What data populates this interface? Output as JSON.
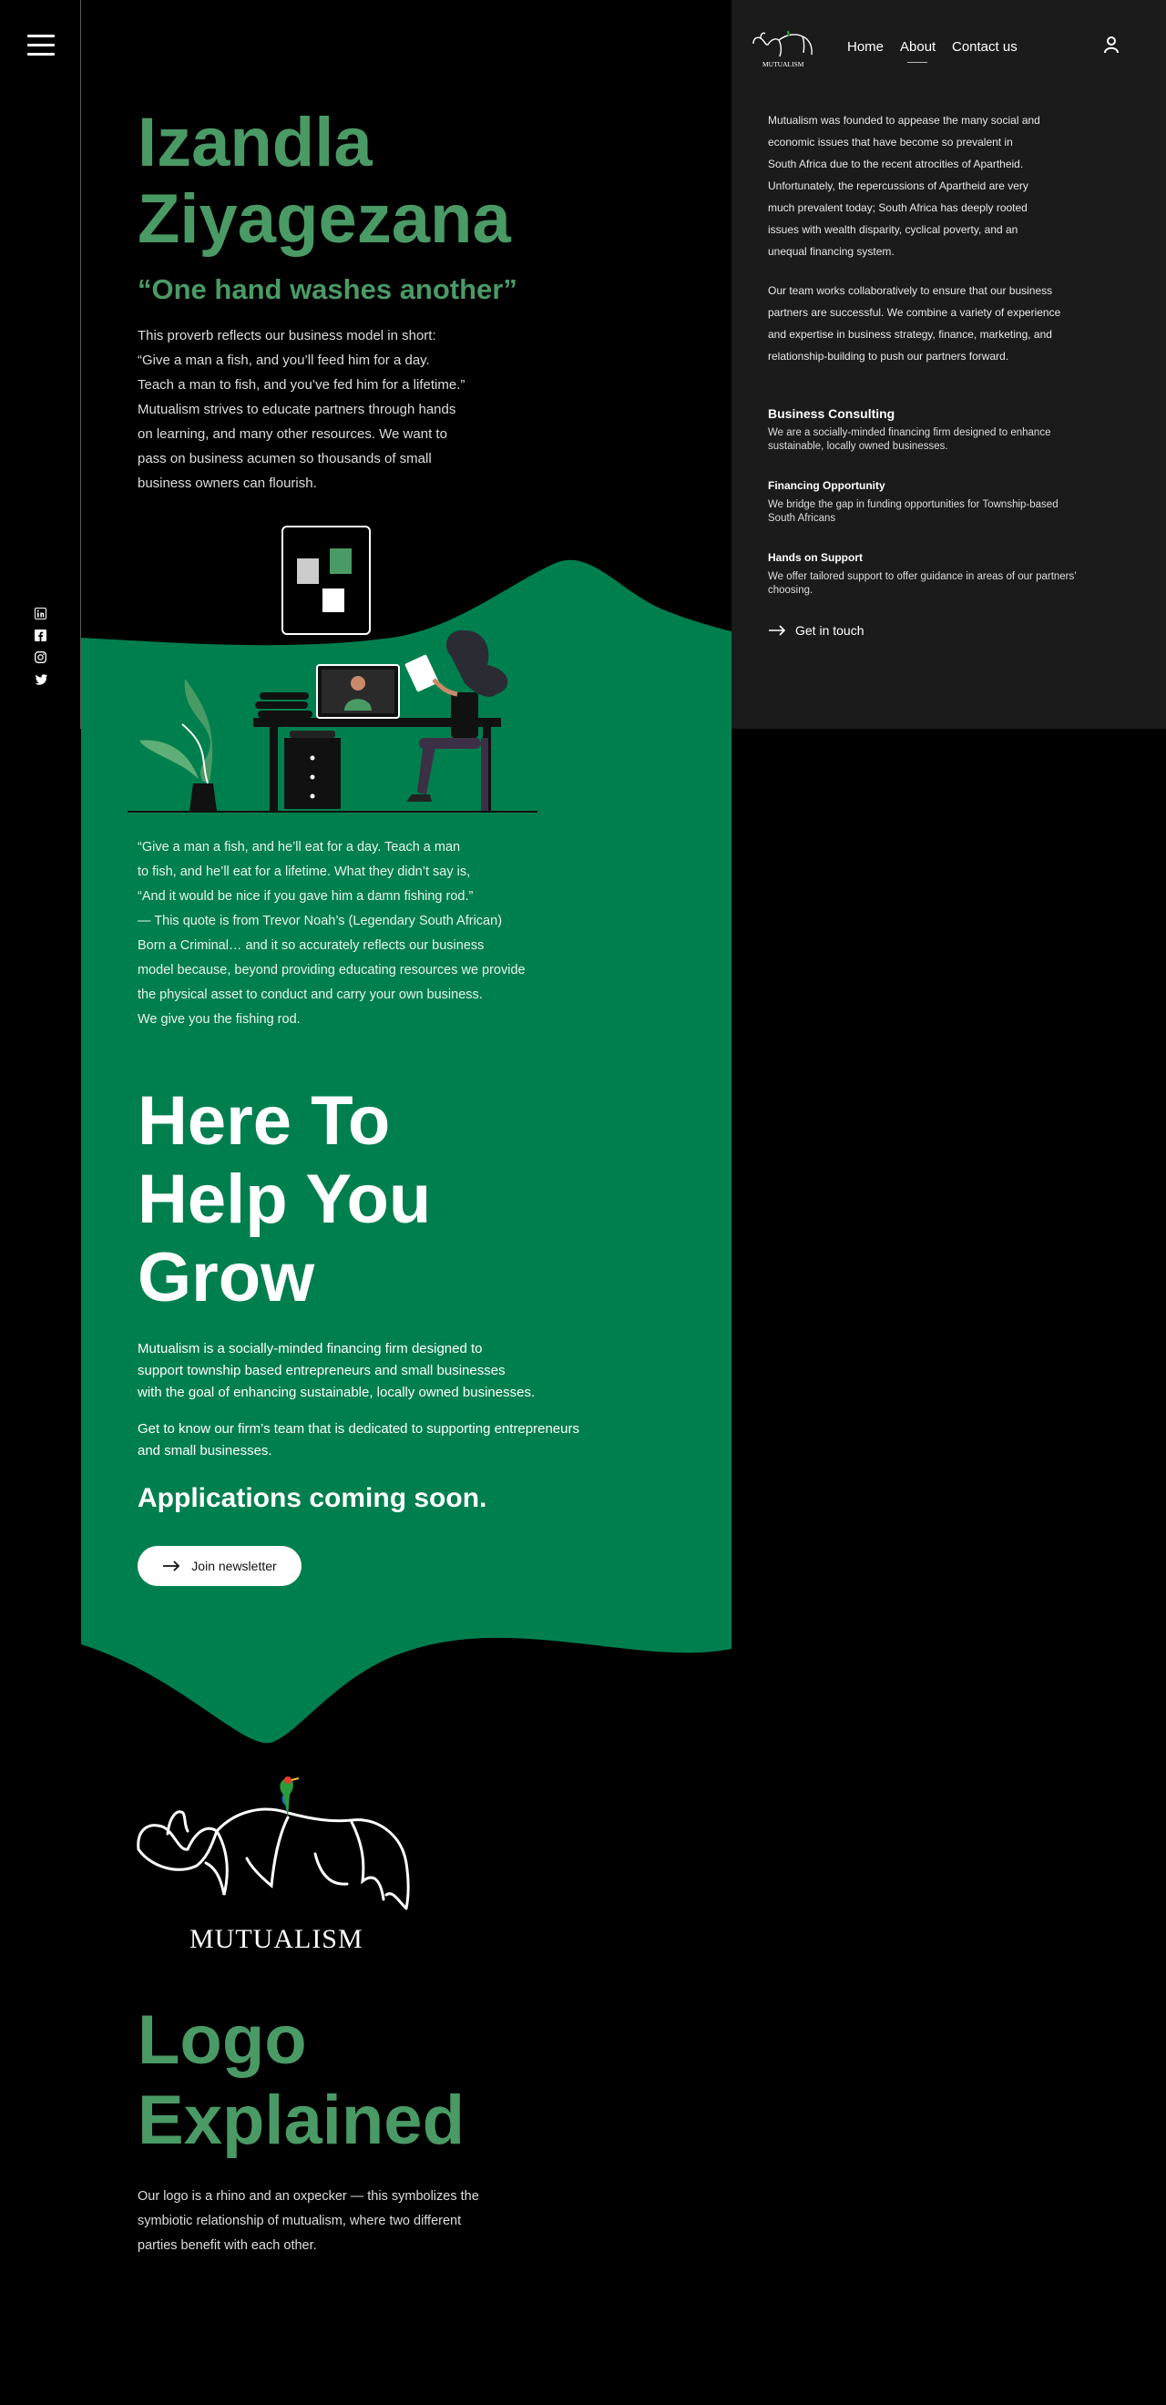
{
  "nav": {
    "logo_text": "MUTUALISM",
    "links": [
      "Home",
      "About",
      "Contact us"
    ],
    "active": "About"
  },
  "hero": {
    "title_line1": "Izandla",
    "title_line2": "Ziyagezana",
    "subtitle": "“One hand washes another”",
    "body": [
      "This proverb reflects our business model in short:",
      "“Give a man a fish, and you’ll feed him for a day.",
      "Teach a man to fish, and you’ve fed him for a lifetime.”",
      "Mutualism strives to educate partners through hands",
      "on learning, and many other resources. We want to",
      "pass on business acumen so thousands of small",
      "business owners can flourish."
    ]
  },
  "about_panel": {
    "para1": [
      "Mutualism was founded to appease the many social and",
      "economic issues that have become so prevalent in",
      "South Africa due to the recent atrocities of Apartheid.",
      "Unfortunately, the repercussions of Apartheid are very",
      "much prevalent today; South Africa has deeply rooted",
      "issues with wealth disparity, cyclical poverty, and an",
      "unequal financing system."
    ],
    "para2": [
      "Our team works collaboratively to ensure that our business",
      "partners are successful. We combine a variety of experience",
      "and expertise in business strategy, finance, marketing, and",
      "relationship-building to push our partners forward."
    ],
    "services": [
      {
        "title": "Business Consulting",
        "desc": "We are a socially-minded financing firm designed to enhance sustainable, locally owned businesses."
      },
      {
        "title": "Financing Opportunity",
        "desc": "We bridge the gap in funding  opportunities for Township-based South Africans"
      },
      {
        "title": "Hands on Support",
        "desc": "We offer tailored support to offer guidance in areas of our partners’ choosing."
      }
    ],
    "cta": "Get in touch"
  },
  "quote": [
    "“Give a man a fish, and he’ll eat for a day. Teach a man",
    "to fish, and he’ll eat for a lifetime. What they didn’t say is,",
    "“And it would be nice if you gave him a damn fishing rod.”",
    "— This quote is from Trevor Noah’s (Legendary South African)",
    "Born a Criminal… and it so accurately reflects our business",
    "model because, beyond providing educating resources we provide",
    "the physical asset to conduct and carry your own business.",
    "We give you the fishing rod."
  ],
  "grow": {
    "title_lines": [
      "Here To",
      "Help You",
      "Grow"
    ],
    "para1": [
      "Mutualism is a socially-minded financing firm designed to",
      "support township based entrepreneurs and small businesses",
      "with the goal of enhancing sustainable, locally owned businesses."
    ],
    "para2": [
      "Get to know our firm’s team that is dedicated to supporting entrepreneurs",
      "and small businesses."
    ],
    "apps": "Applications coming soon.",
    "button": "Join newsletter"
  },
  "logo_section": {
    "logo_text": "MUTUALISM",
    "title_lines": [
      "Logo",
      "Explained"
    ],
    "body": [
      "Our logo is a rhino and an oxpecker — this symbolizes the",
      "symbiotic relationship of mutualism, where two different",
      "parties benefit with each other."
    ]
  },
  "icons": [
    "menu-icon",
    "linkedin-icon",
    "facebook-icon",
    "instagram-icon",
    "twitter-icon",
    "user-icon",
    "arrow-right-icon"
  ],
  "colors": {
    "brand_green": "#007f4e",
    "heading_green": "#4a9a66",
    "panel": "#1b1b1b",
    "background": "#000000"
  }
}
